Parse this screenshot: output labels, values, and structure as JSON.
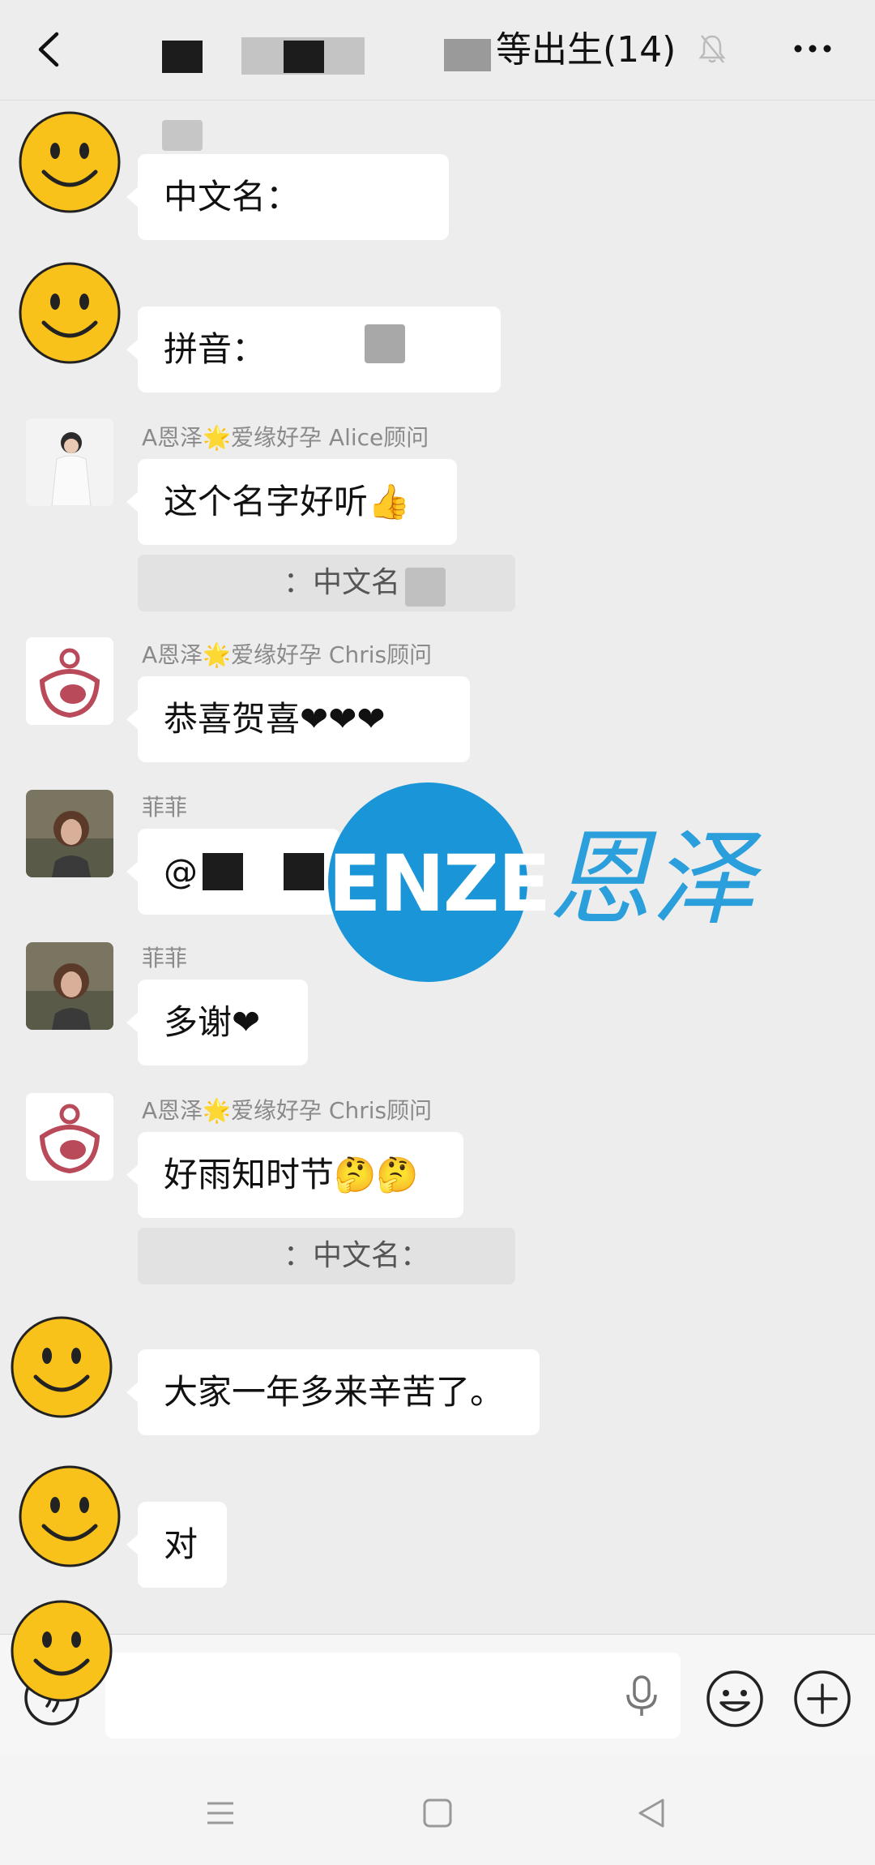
{
  "header": {
    "title": "等出生(14)",
    "back_icon": "chevron-left-icon",
    "mute_icon": "bell-off-icon",
    "more_icon": "more-horizontal-icon"
  },
  "messages": [
    {
      "sender": "",
      "text": "中文名："
    },
    {
      "sender": "",
      "text": "拼音："
    },
    {
      "sender": "A恩泽🌟爱缘好孕 Alice顾问",
      "text": "这个名字好听👍",
      "quote": "：中文名："
    },
    {
      "sender": "A恩泽🌟爱缘好孕 Chris顾问",
      "text": "恭喜贺喜❤❤❤"
    },
    {
      "sender": "菲菲",
      "text": "@"
    },
    {
      "sender": "菲菲",
      "text": "多谢❤"
    },
    {
      "sender": "A恩泽🌟爱缘好孕 Chris顾问",
      "text": "好雨知时节🤔🤔",
      "quote": "：中文名："
    },
    {
      "sender": "",
      "text": "大家一年多来辛苦了。"
    },
    {
      "sender": "",
      "text": "对"
    }
  ],
  "watermark": {
    "logo_text": "ENZE",
    "chinese": "恩泽",
    "color": "#1a96d8"
  },
  "input_bar": {
    "placeholder": "",
    "voice_icon": "voice-icon",
    "mic_icon": "mic-icon",
    "emoji_icon": "emoji-icon",
    "plus_icon": "plus-circle-icon"
  },
  "colors": {
    "background": "#ededed",
    "bubble": "#ffffff",
    "quote": "#e2e2e2",
    "sender": "#8a8a8a",
    "smiley": "#f9c21b"
  }
}
